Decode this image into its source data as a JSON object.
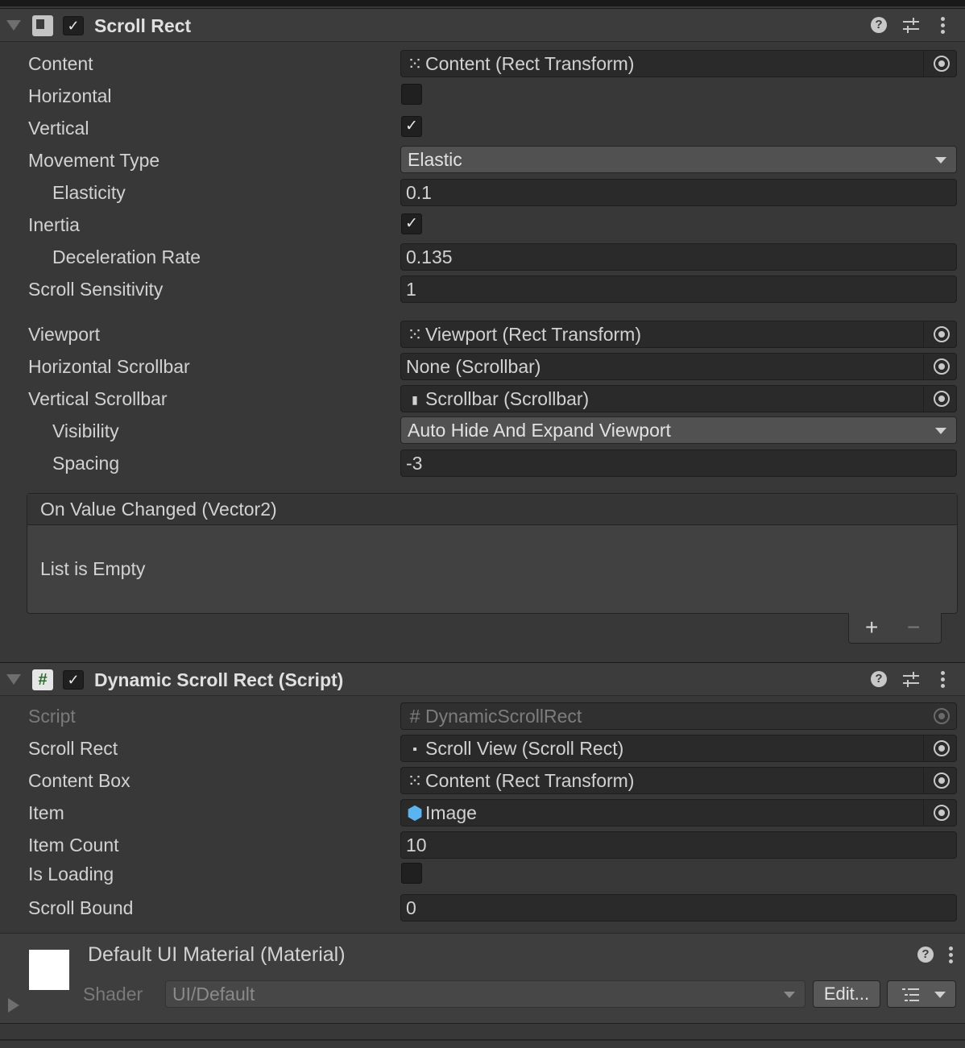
{
  "scroll_rect": {
    "title": "Scroll Rect",
    "enabled_mark": "✓",
    "help": "?",
    "props": {
      "content_label": "Content",
      "content_value": "Content (Rect Transform)",
      "horizontal_label": "Horizontal",
      "horizontal_checked": false,
      "vertical_label": "Vertical",
      "vertical_mark": "✓",
      "movement_type_label": "Movement Type",
      "movement_type_value": "Elastic",
      "elasticity_label": "Elasticity",
      "elasticity_value": "0.1",
      "inertia_label": "Inertia",
      "inertia_mark": "✓",
      "deceleration_label": "Deceleration Rate",
      "deceleration_value": "0.135",
      "scroll_sensitivity_label": "Scroll Sensitivity",
      "scroll_sensitivity_value": "1",
      "viewport_label": "Viewport",
      "viewport_value": "Viewport (Rect Transform)",
      "hscrollbar_label": "Horizontal Scrollbar",
      "hscrollbar_value": "None (Scrollbar)",
      "vscrollbar_label": "Vertical Scrollbar",
      "vscrollbar_value": "Scrollbar (Scrollbar)",
      "visibility_label": "Visibility",
      "visibility_value": "Auto Hide And Expand Viewport",
      "spacing_label": "Spacing",
      "spacing_value": "-3"
    },
    "event": {
      "title": "On Value Changed (Vector2)",
      "empty_text": "List is Empty",
      "add": "+",
      "remove": "−"
    }
  },
  "dynamic_scroll_rect": {
    "title": "Dynamic Scroll Rect (Script)",
    "icon": "#",
    "enabled_mark": "✓",
    "help": "?",
    "props": {
      "script_label": "Script",
      "script_value": "DynamicScrollRect",
      "scroll_rect_label": "Scroll Rect",
      "scroll_rect_value": "Scroll View (Scroll Rect)",
      "content_box_label": "Content Box",
      "content_box_value": "Content (Rect Transform)",
      "item_label": "Item",
      "item_value": "Image",
      "item_count_label": "Item Count",
      "item_count_value": "10",
      "is_loading_label": "Is Loading",
      "is_loading_checked": false,
      "scroll_bound_label": "Scroll Bound",
      "scroll_bound_value": "0"
    }
  },
  "material": {
    "title": "Default UI Material (Material)",
    "help": "?",
    "shader_label": "Shader",
    "shader_value": "UI/Default",
    "edit_label": "Edit..."
  },
  "icons": {
    "rect_transform": "rect-transform-icon",
    "scrollbar": "scrollbar-icon",
    "script": "script-icon",
    "scroll_rect": "scroll-rect-icon",
    "prefab_cube": "prefab-cube-icon"
  },
  "colors": {
    "background": "#383838",
    "field": "#2a2a2a",
    "dropdown": "#515151",
    "text": "#d2d2d2",
    "cube_icon": "#5ab4ef"
  }
}
